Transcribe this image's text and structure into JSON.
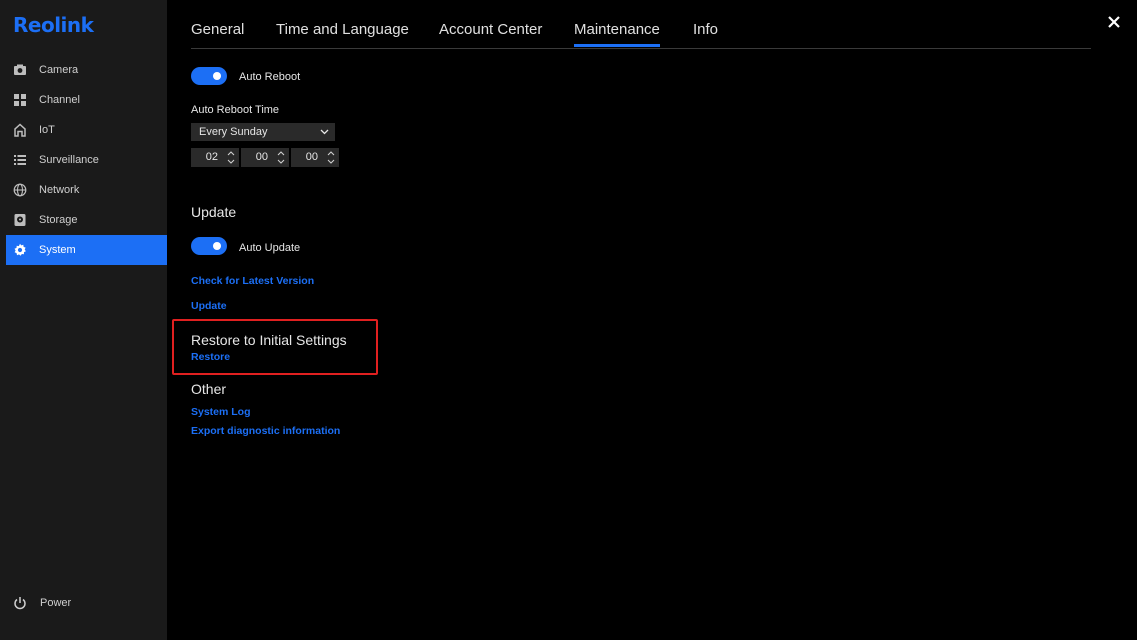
{
  "brand": {
    "logo": "Reolink",
    "accent": "#1c6ff5"
  },
  "sidebar": {
    "items": [
      {
        "label": "Camera",
        "icon": "camera-icon"
      },
      {
        "label": "Channel",
        "icon": "grid-icon"
      },
      {
        "label": "IoT",
        "icon": "home-icon"
      },
      {
        "label": "Surveillance",
        "icon": "list-icon"
      },
      {
        "label": "Network",
        "icon": "globe-icon"
      },
      {
        "label": "Storage",
        "icon": "storage-icon"
      },
      {
        "label": "System",
        "icon": "gear-icon",
        "active": true
      }
    ],
    "power": {
      "label": "Power",
      "icon": "power-icon"
    }
  },
  "tabs": [
    {
      "label": "General"
    },
    {
      "label": "Time and Language"
    },
    {
      "label": "Account Center"
    },
    {
      "label": "Maintenance",
      "active": true
    },
    {
      "label": "Info"
    }
  ],
  "auto_reboot": {
    "toggle_label": "Auto Reboot",
    "enabled": true,
    "time_label": "Auto Reboot Time",
    "schedule": "Every Sunday",
    "hour": "02",
    "minute": "00",
    "second": "00"
  },
  "update": {
    "title": "Update",
    "toggle_label": "Auto Update",
    "enabled": true,
    "check_link": "Check for Latest Version",
    "update_link": "Update"
  },
  "restore": {
    "title": "Restore to Initial Settings",
    "link": "Restore"
  },
  "other": {
    "title": "Other",
    "system_log": "System Log",
    "export": "Export diagnostic information"
  },
  "colors": {
    "highlight_border": "#e02020",
    "sidebar_bg": "#1a1a1a",
    "field_bg": "#2a2a2a"
  }
}
